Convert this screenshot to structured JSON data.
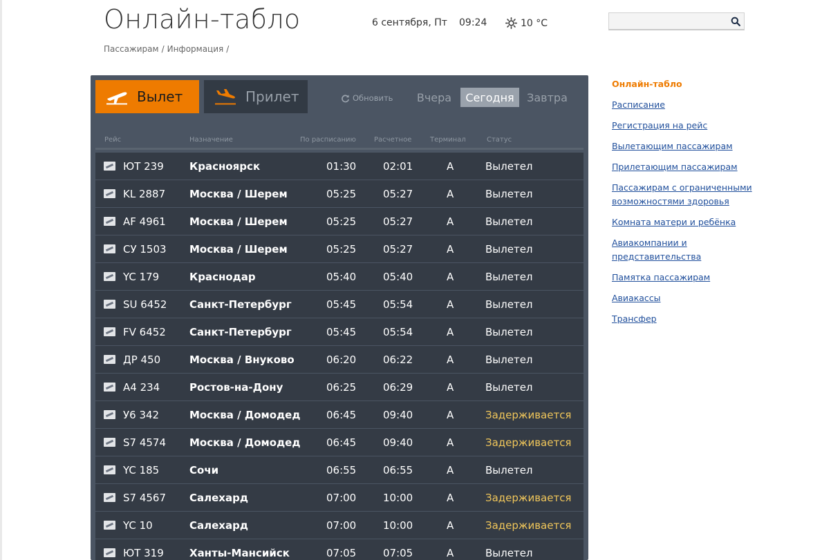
{
  "header": {
    "title": "Онлайн-табло",
    "date": "6 сентября, Пт",
    "time": "09:24",
    "temperature": "10 °C",
    "weather_icon": "sun-icon",
    "search_placeholder": ""
  },
  "breadcrumb": {
    "items": [
      "Пассажирам",
      "Информация"
    ],
    "separator": "/"
  },
  "board": {
    "tabs": {
      "departure": "Вылет",
      "arrival": "Прилет",
      "active": "departure"
    },
    "refresh_label": "Обновить",
    "days": {
      "yesterday": "Вчера",
      "today": "Сегодня",
      "tomorrow": "Завтра",
      "active": "today"
    },
    "columns": {
      "flight": "Рейс",
      "destination": "Назначение",
      "scheduled": "По расписанию",
      "estimated": "Расчетное",
      "terminal": "Терминал",
      "status": "Статус"
    },
    "flights": [
      {
        "flight": "ЮТ 239",
        "destination": "Красноярск",
        "scheduled": "01:30",
        "estimated": "02:01",
        "terminal": "A",
        "status": "Вылетел",
        "delayed": false
      },
      {
        "flight": "KL 2887",
        "destination": "Москва / Шерем",
        "scheduled": "05:25",
        "estimated": "05:27",
        "terminal": "A",
        "status": "Вылетел",
        "delayed": false
      },
      {
        "flight": "AF 4961",
        "destination": "Москва / Шерем",
        "scheduled": "05:25",
        "estimated": "05:27",
        "terminal": "A",
        "status": "Вылетел",
        "delayed": false
      },
      {
        "flight": "СУ 1503",
        "destination": "Москва / Шерем",
        "scheduled": "05:25",
        "estimated": "05:27",
        "terminal": "A",
        "status": "Вылетел",
        "delayed": false
      },
      {
        "flight": "YC 179",
        "destination": "Краснодар",
        "scheduled": "05:40",
        "estimated": "05:40",
        "terminal": "A",
        "status": "Вылетел",
        "delayed": false
      },
      {
        "flight": "SU 6452",
        "destination": "Санкт-Петербург",
        "scheduled": "05:45",
        "estimated": "05:54",
        "terminal": "A",
        "status": "Вылетел",
        "delayed": false
      },
      {
        "flight": "FV 6452",
        "destination": "Санкт-Петербург",
        "scheduled": "05:45",
        "estimated": "05:54",
        "terminal": "A",
        "status": "Вылетел",
        "delayed": false
      },
      {
        "flight": "ДР 450",
        "destination": "Москва / Внуково",
        "scheduled": "06:20",
        "estimated": "06:22",
        "terminal": "A",
        "status": "Вылетел",
        "delayed": false
      },
      {
        "flight": "A4 234",
        "destination": "Ростов-на-Дону",
        "scheduled": "06:25",
        "estimated": "06:29",
        "terminal": "A",
        "status": "Вылетел",
        "delayed": false
      },
      {
        "flight": "У6 342",
        "destination": "Москва / Домодед",
        "scheduled": "06:45",
        "estimated": "09:40",
        "terminal": "A",
        "status": "Задерживается",
        "delayed": true
      },
      {
        "flight": "S7 4574",
        "destination": "Москва / Домодед",
        "scheduled": "06:45",
        "estimated": "09:40",
        "terminal": "A",
        "status": "Задерживается",
        "delayed": true
      },
      {
        "flight": "YC 185",
        "destination": "Сочи",
        "scheduled": "06:55",
        "estimated": "06:55",
        "terminal": "A",
        "status": "Вылетел",
        "delayed": false
      },
      {
        "flight": "S7 4567",
        "destination": "Салехард",
        "scheduled": "07:00",
        "estimated": "10:00",
        "terminal": "A",
        "status": "Задерживается",
        "delayed": true
      },
      {
        "flight": "YC 10",
        "destination": "Салехард",
        "scheduled": "07:00",
        "estimated": "10:00",
        "terminal": "A",
        "status": "Задерживается",
        "delayed": true
      },
      {
        "flight": "ЮТ 319",
        "destination": "Ханты-Мансийск",
        "scheduled": "07:05",
        "estimated": "07:05",
        "terminal": "A",
        "status": "Вылетел",
        "delayed": false
      }
    ]
  },
  "sidebar": {
    "items": [
      {
        "label": "Онлайн-табло",
        "active": true
      },
      {
        "label": "Расписание",
        "active": false
      },
      {
        "label": "Регистрация на рейс",
        "active": false
      },
      {
        "label": "Вылетающим пассажирам",
        "active": false
      },
      {
        "label": "Прилетающим пассажирам",
        "active": false
      },
      {
        "label": "Пассажирам с ограниченными возможностями здоровья",
        "active": false
      },
      {
        "label": "Комната матери и ребёнка",
        "active": false
      },
      {
        "label": "Авиакомпании и представительства",
        "active": false
      },
      {
        "label": "Памятка пассажирам",
        "active": false
      },
      {
        "label": "Авиакассы",
        "active": false
      },
      {
        "label": "Трансфер",
        "active": false
      }
    ]
  },
  "colors": {
    "accent": "#ee7b00",
    "board_bg": "#4b5563",
    "row_bg": "#343b45",
    "delayed": "#f0c65a",
    "link": "#1f4e9b"
  }
}
